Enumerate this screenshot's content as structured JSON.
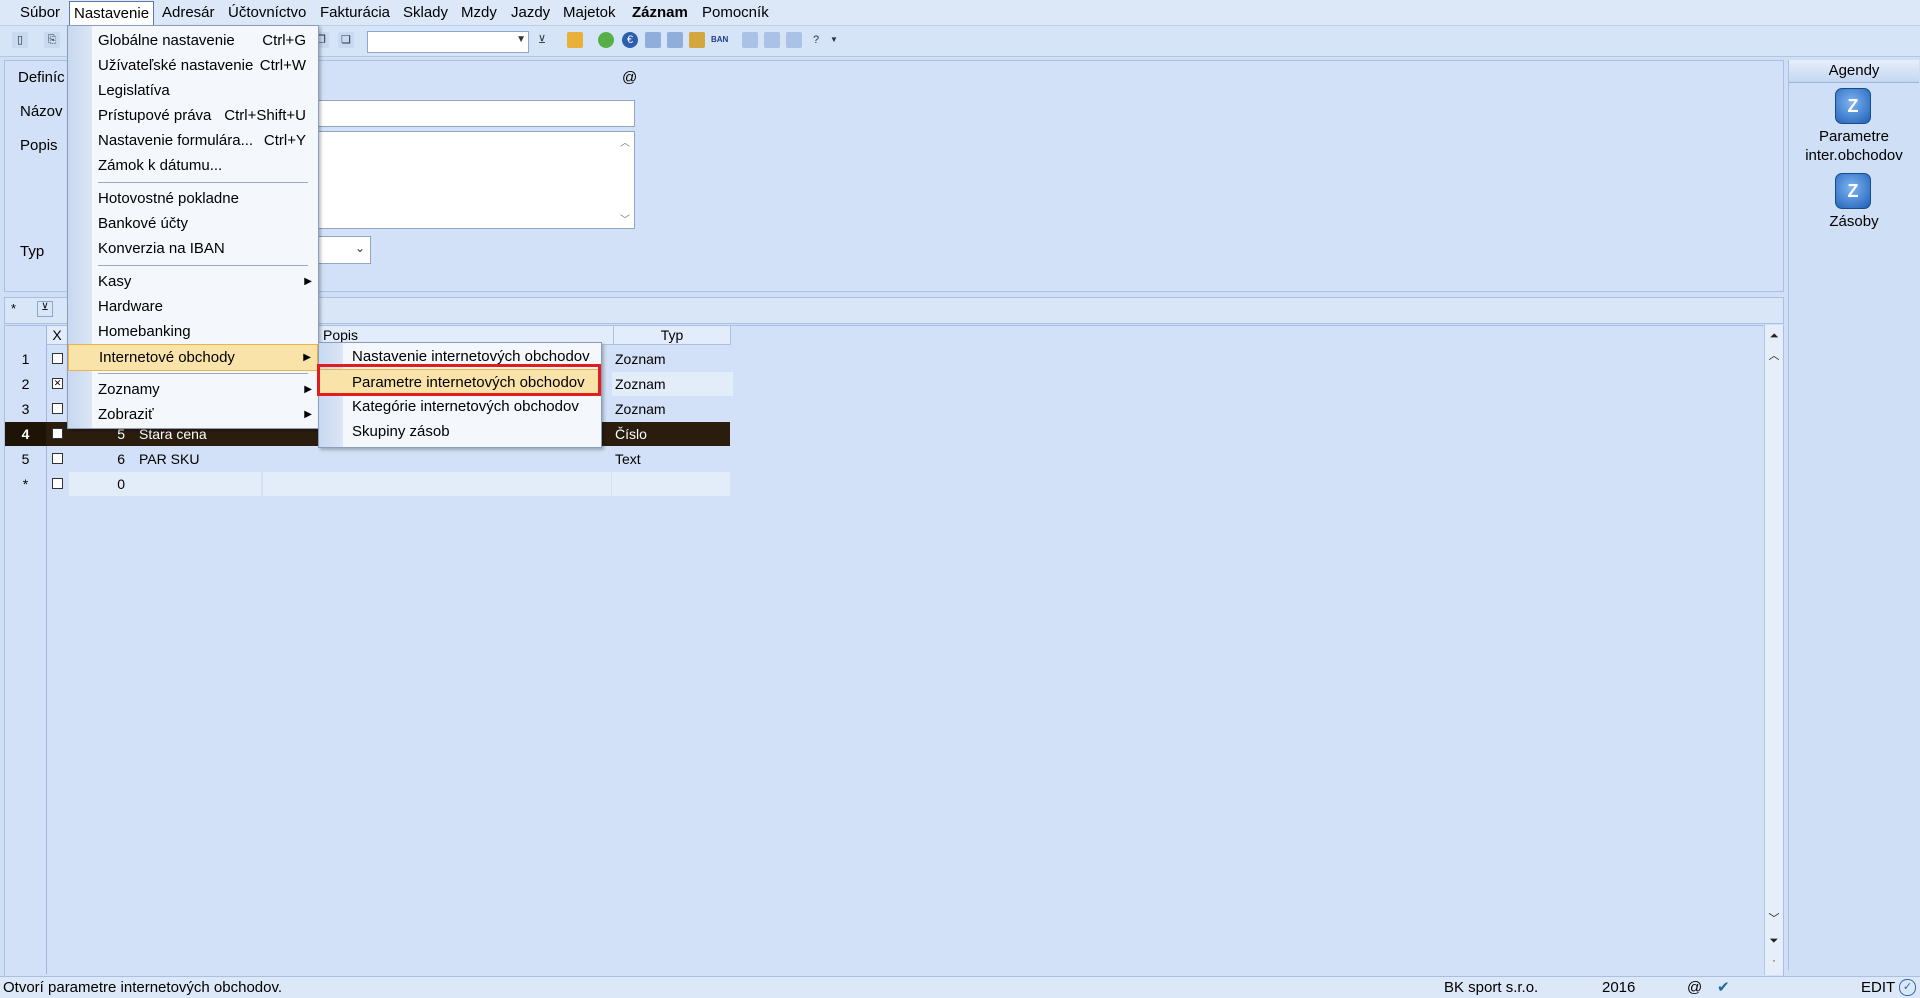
{
  "menubar": [
    {
      "label": "Súbor",
      "active": false,
      "bold": false
    },
    {
      "label": "Nastavenie",
      "active": true,
      "bold": false
    },
    {
      "label": "Adresár",
      "active": false,
      "bold": false
    },
    {
      "label": "Účtovníctvo",
      "active": false,
      "bold": false
    },
    {
      "label": "Fakturácia",
      "active": false,
      "bold": false
    },
    {
      "label": "Sklady",
      "active": false,
      "bold": false
    },
    {
      "label": "Mzdy",
      "active": false,
      "bold": false
    },
    {
      "label": "Jazdy",
      "active": false,
      "bold": false
    },
    {
      "label": "Majetok",
      "active": false,
      "bold": false
    },
    {
      "label": "Záznam",
      "active": false,
      "bold": true
    },
    {
      "label": "Pomocník",
      "active": false,
      "bold": false
    }
  ],
  "form": {
    "label_definition": "Definíc",
    "label_name": "Názov",
    "label_desc": "Popis",
    "label_type": "Typ",
    "at_symbol": "@"
  },
  "agendy": {
    "title": "Agendy",
    "items": [
      {
        "label_line1": "Parametre",
        "label_line2": "inter.obchodov",
        "icon": "parameters-icon"
      },
      {
        "label_line1": "Zásoby",
        "label_line2": "",
        "icon": "stock-icon"
      }
    ]
  },
  "grid": {
    "headers": {
      "x": "X",
      "popis": "Popis",
      "typ": "Typ"
    },
    "rows": [
      {
        "num": "1",
        "checked": false,
        "id": "",
        "name": "",
        "typ": "Zoznam"
      },
      {
        "num": "2",
        "checked": true,
        "id": "",
        "name": "",
        "typ": "Zoznam"
      },
      {
        "num": "3",
        "checked": false,
        "id": "",
        "name": "",
        "typ": "Zoznam"
      },
      {
        "num": "4",
        "checked": false,
        "id": "5",
        "name": "Stara cena",
        "typ": "Číslo"
      },
      {
        "num": "5",
        "checked": false,
        "id": "6",
        "name": "PAR SKU",
        "typ": "Text"
      },
      {
        "num": "*",
        "checked": false,
        "id": "0",
        "name": "",
        "typ": ""
      }
    ]
  },
  "menu_nastavenie": {
    "items": [
      {
        "label": "Globálne nastavenie",
        "shortcut": "Ctrl+G"
      },
      {
        "label": "Užívateľské nastavenie",
        "shortcut": "Ctrl+W"
      },
      {
        "label": "Legislatíva",
        "shortcut": ""
      },
      {
        "label": "Prístupové práva",
        "shortcut": "Ctrl+Shift+U"
      },
      {
        "label": "Nastavenie formulára...",
        "shortcut": "Ctrl+Y"
      },
      {
        "label": "Zámok k dátumu...",
        "shortcut": ""
      },
      {
        "label": "Hotovostné pokladne",
        "shortcut": ""
      },
      {
        "label": "Bankové účty",
        "shortcut": ""
      },
      {
        "label": "Konverzia na IBAN",
        "shortcut": ""
      },
      {
        "label": "Kasy",
        "shortcut": ""
      },
      {
        "label": "Hardware",
        "shortcut": ""
      },
      {
        "label": "Homebanking",
        "shortcut": ""
      },
      {
        "label": "Internetové obchody",
        "shortcut": ""
      },
      {
        "label": "Zoznamy",
        "shortcut": ""
      },
      {
        "label": "Zobraziť",
        "shortcut": ""
      }
    ]
  },
  "submenu_internet": {
    "items": [
      {
        "label": "Nastavenie internetových obchodov"
      },
      {
        "label": "Parametre internetových obchodov"
      },
      {
        "label": "Kategórie internetových obchodov"
      },
      {
        "label": "Skupiny zásob"
      }
    ]
  },
  "status": {
    "message": "Otvorí parametre internetových obchodov.",
    "company": "BK sport  s.r.o.",
    "year": "2016",
    "at": "@",
    "mode": "EDIT"
  },
  "toolbar": {
    "ban_label": "BAN"
  },
  "colors": {
    "highlight": "#f9e3a8",
    "selected_row": "#2a1d0e",
    "annotation_box": "#e31d1d"
  }
}
